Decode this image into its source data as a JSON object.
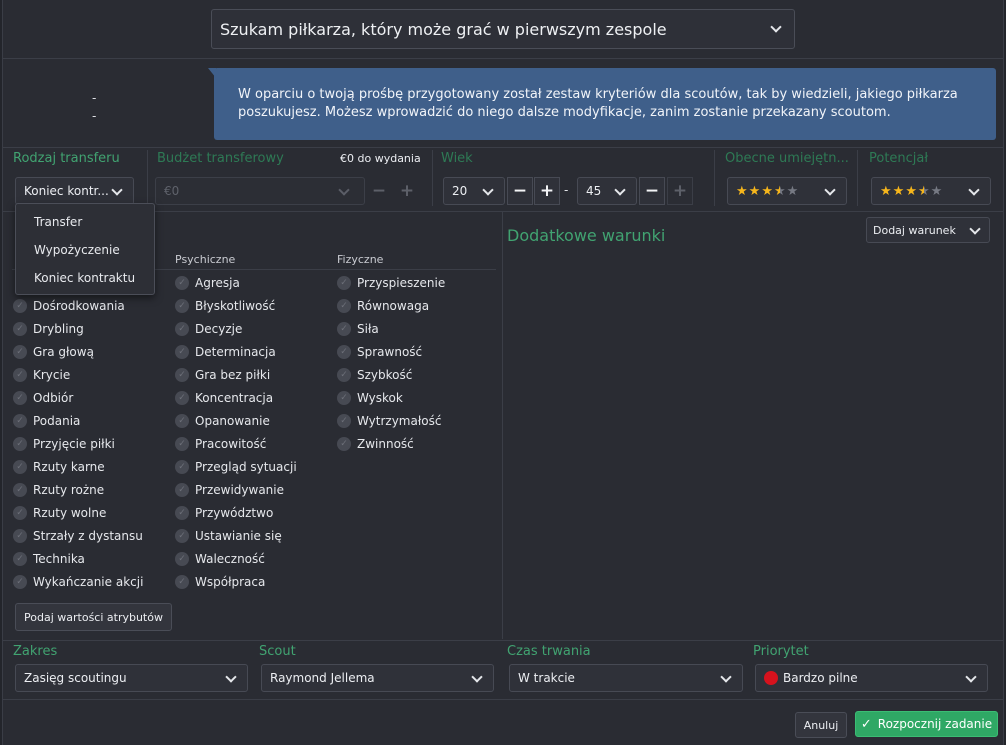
{
  "request": {
    "selected": "Szukam piłkarza, który może grać w pierwszym zespole"
  },
  "left_placeholders": [
    "-",
    "-"
  ],
  "info_message": "W oparciu o twoją prośbę przygotowany został zestaw kryteriów dla scoutów, tak by wiedzieli, jakiego piłkarza poszukujesz. Możesz wprowadzić do niego dalsze modyfikacje, zanim zostanie przekazany scoutom.",
  "transfer_type": {
    "label": "Rodzaj transferu",
    "selected": "Koniec kontr...",
    "options": [
      "Transfer",
      "Wypożyczenie",
      "Koniec kontraktu"
    ]
  },
  "budget": {
    "label": "Budżet transferowy",
    "available": "€0 do wydania",
    "placeholder": "€0",
    "minus": "−",
    "plus": "+"
  },
  "age": {
    "label": "Wiek",
    "min": "20",
    "max": "45",
    "separator": "-",
    "minus": "−",
    "plus": "+"
  },
  "current_ability": {
    "label": "Obecne umiejętn...",
    "stars": 3.5
  },
  "potential": {
    "label": "Potencjał",
    "stars": 3.5
  },
  "attributes": {
    "technical": [
      "Dośrodkowania",
      "Drybling",
      "Gra głową",
      "Krycie",
      "Odbiór",
      "Podania",
      "Przyjęcie piłki",
      "Rzuty karne",
      "Rzuty rożne",
      "Rzuty wolne",
      "Strzały z dystansu",
      "Technika",
      "Wykańczanie akcji"
    ],
    "mental_header": "Psychiczne",
    "mental": [
      "Agresja",
      "Błyskotliwość",
      "Decyzje",
      "Determinacja",
      "Gra bez piłki",
      "Koncentracja",
      "Opanowanie",
      "Pracowitość",
      "Przegląd sytuacji",
      "Przewidywanie",
      "Przywództwo",
      "Ustawianie się",
      "Waleczność",
      "Współpraca"
    ],
    "physical_header": "Fizyczne",
    "physical": [
      "Przyspieszenie",
      "Równowaga",
      "Siła",
      "Sprawność",
      "Szybkość",
      "Wyskok",
      "Wytrzymałość",
      "Zwinność"
    ],
    "give_values_button": "Podaj wartości atrybutów"
  },
  "additional": {
    "title": "Dodatkowe warunki",
    "add_button": "Dodaj warunek"
  },
  "bottom": {
    "range_label": "Zakres",
    "range_value": "Zasięg scoutingu",
    "scout_label": "Scout",
    "scout_value": "Raymond Jellema",
    "duration_label": "Czas trwania",
    "duration_value": "W trakcie",
    "priority_label": "Priorytet",
    "priority_value": "Bardzo pilne",
    "priority_color": "#d6121d"
  },
  "actions": {
    "cancel": "Anuluj",
    "start": "Rozpocznij zadanie"
  },
  "colors": {
    "accent_green": "#41a371",
    "info_blue": "#3f5f8a",
    "star": "#f6b61c",
    "confirm_green": "#2fa865"
  }
}
